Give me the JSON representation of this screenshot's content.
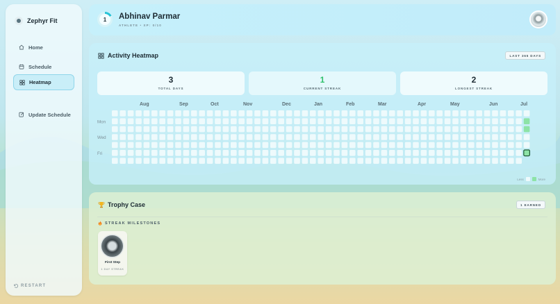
{
  "app": {
    "name": "Zephyr Fit"
  },
  "sidebar": {
    "items": [
      {
        "label": "Home",
        "icon": "home-icon"
      },
      {
        "label": "Schedule",
        "icon": "calendar-icon"
      },
      {
        "label": "Heatmap",
        "icon": "grid-icon",
        "active": true
      },
      {
        "label": "Update Schedule",
        "icon": "edit-icon"
      }
    ],
    "restart_label": "RESTART"
  },
  "header": {
    "level": "1",
    "name": "Abhinav Parmar",
    "subtitle": "ATHLETE • XP: 0/10",
    "accent_color": "#27c3d6"
  },
  "heatmap": {
    "title": "Activity Heatmap",
    "range_label": "LAST 365 DAYS",
    "stats": [
      {
        "value": "3",
        "label": "TOTAL DAYS"
      },
      {
        "value": "1",
        "label": "CURRENT STREAK",
        "highlight": true
      },
      {
        "value": "2",
        "label": "LONGEST STREAK"
      }
    ],
    "months": [
      "Aug",
      "Sep",
      "Oct",
      "Nov",
      "Dec",
      "Jan",
      "Feb",
      "Mar",
      "Apr",
      "May",
      "Jun",
      "Jul"
    ],
    "day_labels": [
      "Mon",
      "Wed",
      "Fri"
    ],
    "weeks": 53,
    "active_days": [
      {
        "week": 52,
        "day": 1,
        "level": 2
      },
      {
        "week": 52,
        "day": 2,
        "level": 2
      },
      {
        "week": 52,
        "day": 5,
        "level": 2,
        "today": true
      }
    ],
    "legend": {
      "less": "Less",
      "more": "More"
    },
    "colors": {
      "empty": "#eefafc",
      "active": "#8de3a6",
      "today_border": "#1e5a35"
    }
  },
  "trophies": {
    "title": "Trophy Case",
    "earned_label": "1 EARNED",
    "section_label": "STREAK MILESTONES",
    "badges": [
      {
        "name": "First Step",
        "subtitle": "1 DAY STREAK"
      }
    ]
  }
}
